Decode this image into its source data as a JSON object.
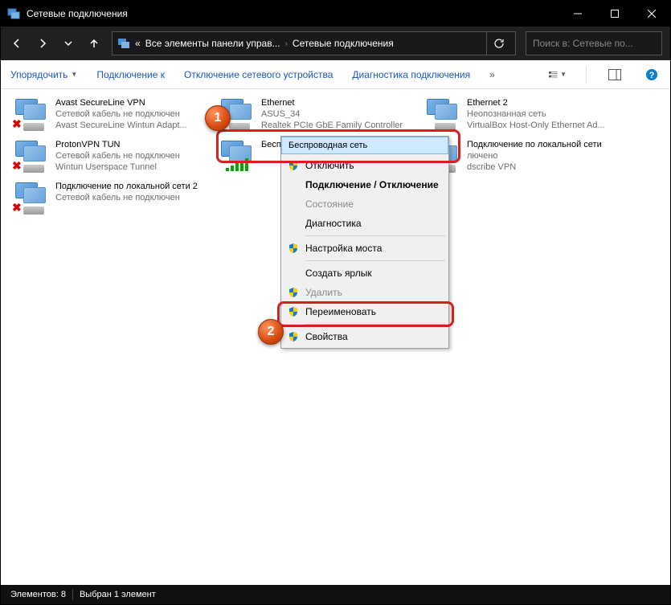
{
  "window": {
    "title": "Сетевые подключения"
  },
  "breadcrumb": {
    "prefix": "«",
    "seg1": "Все элементы панели управ...",
    "seg2": "Сетевые подключения"
  },
  "search": {
    "placeholder": "Поиск в: Сетевые по..."
  },
  "toolbar": {
    "organize": "Упорядочить",
    "connect": "Подключение к",
    "disable": "Отключение сетевого устройства",
    "diagnose": "Диагностика подключения"
  },
  "connections": [
    {
      "name": "Avast SecureLine VPN",
      "status": "Сетевой кабель не подключен",
      "device": "Avast SecureLine Wintun Adapt...",
      "x": true,
      "type": "cable"
    },
    {
      "name": "Ethernet",
      "status": "ASUS_34",
      "device": "Realtek PCIe GbE Family Controller",
      "x": false,
      "type": "cable"
    },
    {
      "name": "Ethernet 2",
      "status": "Неопознанная сеть",
      "device": "VirtualBox Host-Only Ethernet Ad...",
      "x": false,
      "type": "cable"
    },
    {
      "name": "ProtonVPN TUN",
      "status": "Сетевой кабель не подключен",
      "device": "Wintun Userspace Tunnel",
      "x": true,
      "type": "cable"
    },
    {
      "name": "Беспроводная сеть",
      "status": "",
      "device": "",
      "x": false,
      "type": "wifi"
    },
    {
      "name": "Подключение по локальной сети",
      "status": "лючено",
      "device": "dscribe VPN",
      "x": false,
      "type": "cable"
    },
    {
      "name": "Подключение по локальной сети 2",
      "status": "Сетевой кабель не подключен",
      "device": "",
      "x": true,
      "type": "cable"
    }
  ],
  "context": {
    "header": "Беспроводная сеть",
    "items": [
      {
        "label": "Отключить",
        "shield": true,
        "bold": false,
        "disabled": false
      },
      {
        "label": "Подключение / Отключение",
        "shield": false,
        "bold": true,
        "disabled": false
      },
      {
        "label": "Состояние",
        "shield": false,
        "bold": false,
        "disabled": true
      },
      {
        "label": "Диагностика",
        "shield": false,
        "bold": false,
        "disabled": false
      },
      {
        "sep": true
      },
      {
        "label": "Настройка моста",
        "shield": true,
        "bold": false,
        "disabled": false
      },
      {
        "sep": true
      },
      {
        "label": "Создать ярлык",
        "shield": false,
        "bold": false,
        "disabled": false
      },
      {
        "label": "Удалить",
        "shield": true,
        "bold": false,
        "disabled": true
      },
      {
        "label": "Переименовать",
        "shield": true,
        "bold": false,
        "disabled": false
      },
      {
        "sep": true
      },
      {
        "label": "Свойства",
        "shield": true,
        "bold": false,
        "disabled": false
      }
    ]
  },
  "statusbar": {
    "count": "Элементов: 8",
    "selected": "Выбран 1 элемент"
  },
  "badges": {
    "one": "1",
    "two": "2"
  }
}
